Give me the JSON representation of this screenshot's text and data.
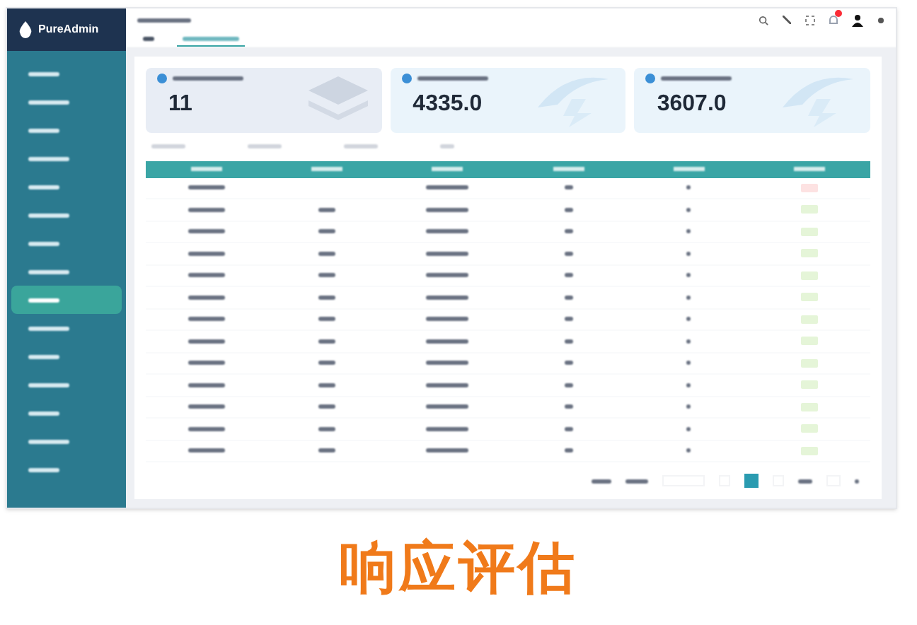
{
  "sidebar": {
    "brand": "PureAdmin",
    "items": [
      {
        "selected": false
      },
      {
        "selected": false
      },
      {
        "selected": false
      },
      {
        "selected": false
      },
      {
        "selected": false
      },
      {
        "selected": false
      },
      {
        "selected": false
      },
      {
        "selected": false
      },
      {
        "selected": true
      },
      {
        "selected": false
      },
      {
        "selected": false
      },
      {
        "selected": false
      },
      {
        "selected": false
      },
      {
        "selected": false
      },
      {
        "selected": false
      }
    ]
  },
  "tabs": [
    {
      "selected": false
    },
    {
      "selected": true
    }
  ],
  "stats": [
    {
      "value": "11",
      "kind": "layers"
    },
    {
      "value": "4335.0",
      "kind": "bolt"
    },
    {
      "value": "3607.0",
      "kind": "bolt"
    }
  ],
  "table": {
    "rows": [
      {
        "color": "#fde2e2",
        "type_blank": true
      },
      {
        "color": "#e5f5d8",
        "type_blank": false
      },
      {
        "color": "#e5f5d8",
        "type_blank": false
      },
      {
        "color": "#e5f5d8",
        "type_blank": false
      },
      {
        "color": "#e5f5d8",
        "type_blank": false
      },
      {
        "color": "#e5f5d8",
        "type_blank": false
      },
      {
        "color": "#e5f5d8",
        "type_blank": false
      },
      {
        "color": "#e5f5d8",
        "type_blank": false
      },
      {
        "color": "#e5f5d8",
        "type_blank": false
      },
      {
        "color": "#e5f5d8",
        "type_blank": false
      },
      {
        "color": "#e5f5d8",
        "type_blank": false
      },
      {
        "color": "#e5f5d8",
        "type_blank": false
      },
      {
        "color": "#e5f5d8",
        "type_blank": false
      }
    ]
  },
  "caption": "响应评估"
}
